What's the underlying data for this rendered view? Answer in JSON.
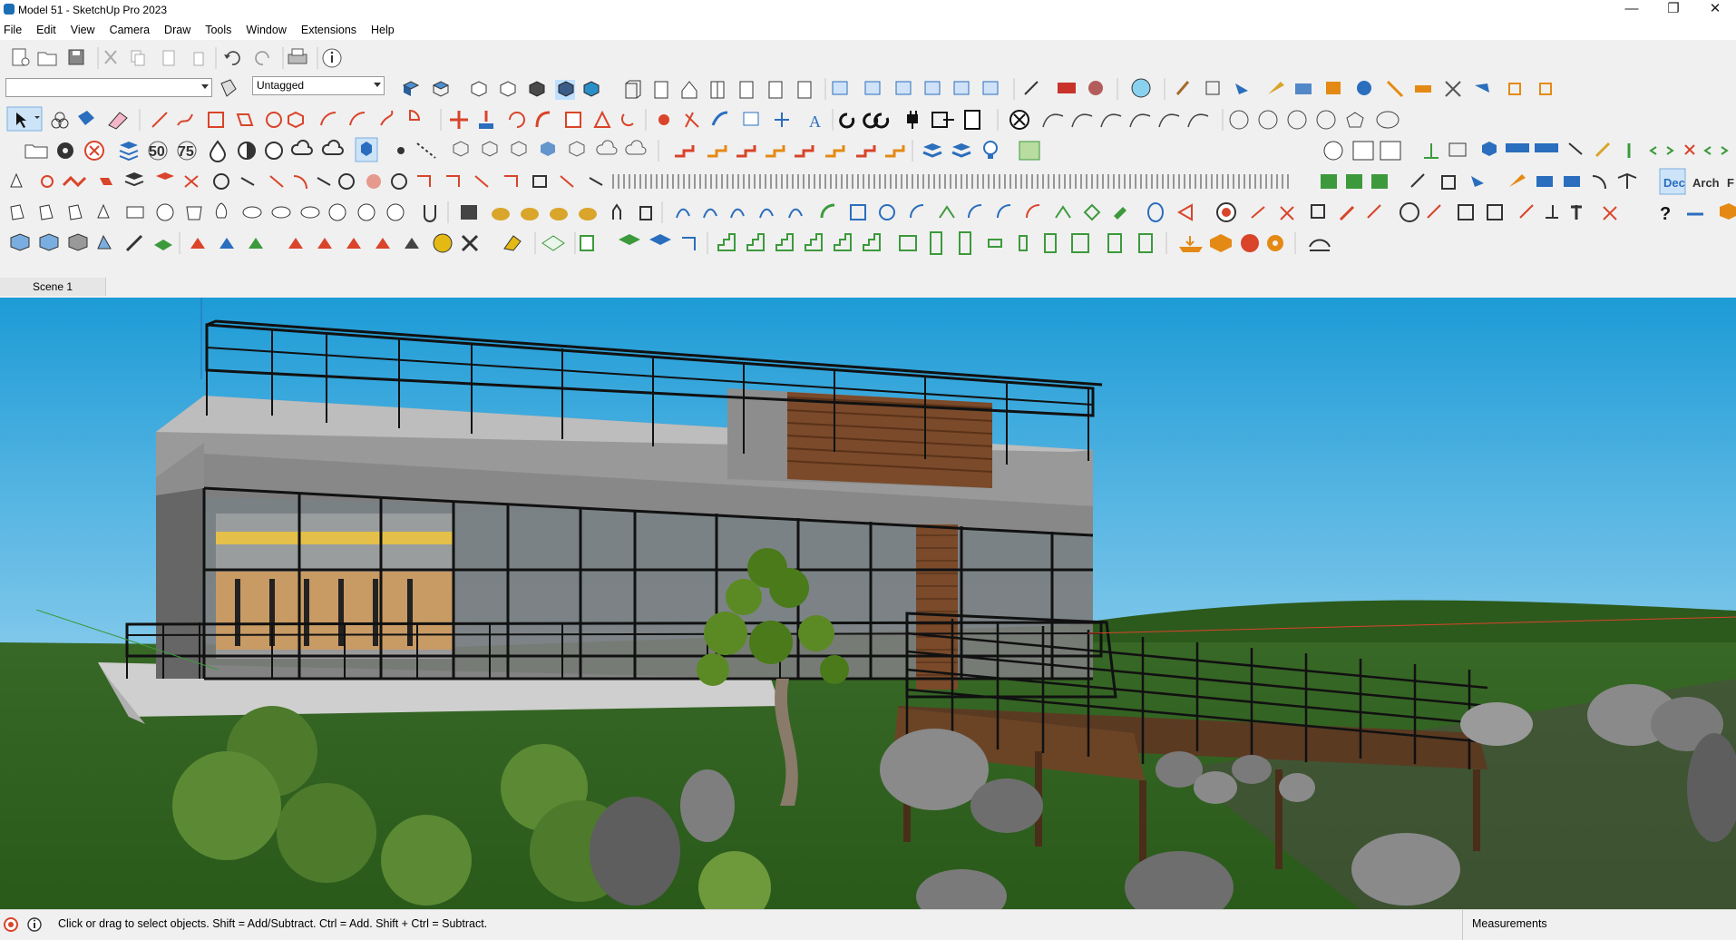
{
  "window": {
    "title": "Model 51 - SketchUp Pro 2023",
    "minimize_glyph": "—",
    "maximize_glyph": "❐",
    "close_glyph": "✕"
  },
  "menu": [
    {
      "label": "File"
    },
    {
      "label": "Edit"
    },
    {
      "label": "View"
    },
    {
      "label": "Camera"
    },
    {
      "label": "Draw"
    },
    {
      "label": "Tools"
    },
    {
      "label": "Window"
    },
    {
      "label": "Extensions"
    },
    {
      "label": "Help"
    }
  ],
  "toolbar": {
    "tag_dropdown": "Untagged",
    "style_dropdown": "",
    "dec_label": "Dec",
    "arch_label": "Arch",
    "f_label": "F",
    "fifty_label": "50",
    "seventy_five_label": "75"
  },
  "scene": {
    "tab_label": "Scene 1"
  },
  "status": {
    "hint": "Click or drag to select objects. Shift = Add/Subtract. Ctrl = Add. Shift + Ctrl = Subtract.",
    "measurements_label": "Measurements"
  },
  "colors": {
    "sky_top": "#1d9bd6",
    "sky_bottom": "#bfe6f5",
    "grass": "#2d5a1d",
    "wood": "#7a4a2a",
    "icon_blue": "#2a6ebd",
    "icon_red": "#d9442a",
    "icon_orange": "#e48a14",
    "icon_green": "#3c9a3c"
  }
}
